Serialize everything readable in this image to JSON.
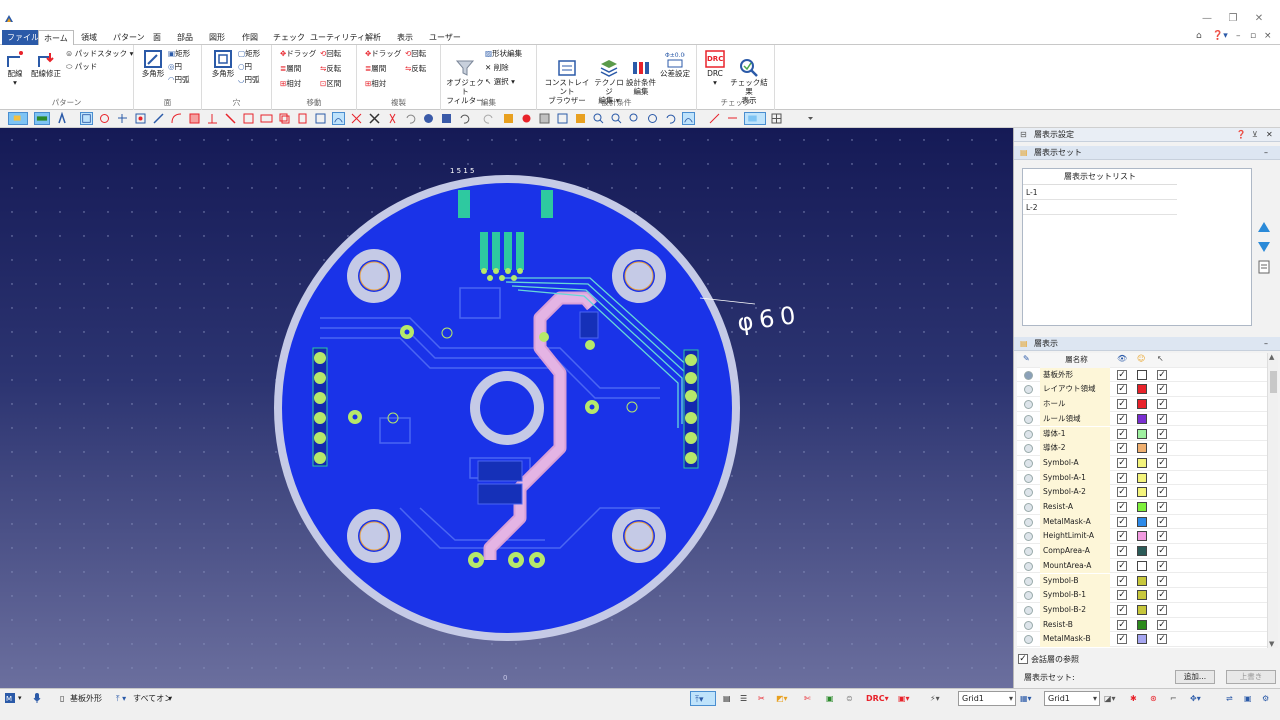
{
  "menu": {
    "items": [
      "ファイル",
      "ホーム",
      "領域",
      "パターン",
      "面",
      "部品",
      "図形",
      "作図",
      "チェック",
      "ユーティリティ",
      "解析",
      "表示",
      "ユーザー"
    ]
  },
  "ribbon": {
    "pattern": {
      "route": "配線",
      "route_edit": "配線修正",
      "pad_stack": "パッドスタック ▾",
      "pad": "パッド",
      "label": "パターン"
    },
    "plane": {
      "polygon": "多角形",
      "rect": "矩形",
      "circle": "円",
      "arc": "円弧",
      "label": "面"
    },
    "hole": {
      "polygon": "多角形",
      "rect": "矩形",
      "circle": "円",
      "arc": "円弧",
      "label": "穴"
    },
    "move": {
      "drag": "ドラッグ",
      "rotate": "回転",
      "layer": "層間",
      "flip": "反転",
      "relative": "相対",
      "mirror": "区間",
      "label": "移動"
    },
    "copy": {
      "drag": "ドラッグ",
      "rotate": "回転",
      "layer": "層間",
      "flip": "反転",
      "relative": "相対",
      "label": "複製"
    },
    "edit": {
      "filter": "オブジェクト\nフィルター",
      "shape_edit": "形状編集",
      "delete": "削除",
      "select": "選択 ▾",
      "label": "編集"
    },
    "design": {
      "constraint": "コンストレイント\nブラウザー",
      "tech": "テクノロジ\n編集 ▾",
      "cond": "設計条件\n編集",
      "tol": "公差設定",
      "label": "設計条件"
    },
    "check": {
      "drc": "DRC",
      "result": "チェック結果\n表示",
      "label": "チェック"
    }
  },
  "canvas": {
    "dimension_label": "φ60",
    "mark_label": "1 5 1 5",
    "origin_mark": "0"
  },
  "panel": {
    "title": "層表示設定",
    "set_section": "層表示セット",
    "set_list_header": "層表示セットリスト",
    "sets": [
      "L-1",
      "L-2"
    ],
    "layer_section": "層表示",
    "col_name": "層名称",
    "layers": [
      {
        "name": "基板外形",
        "color": "#ffffff"
      },
      {
        "name": "レイアウト領域",
        "color": "#e8222a"
      },
      {
        "name": "ホール",
        "color": "#e8222a"
      },
      {
        "name": "ルール領域",
        "color": "#7a2fd1"
      },
      {
        "name": "導体-1",
        "color": "#9ff0a0"
      },
      {
        "name": "導体-2",
        "color": "#f0b070"
      },
      {
        "name": "Symbol-A",
        "color": "#f4f47c"
      },
      {
        "name": "Symbol-A-1",
        "color": "#f4f47c"
      },
      {
        "name": "Symbol-A-2",
        "color": "#f4f47c"
      },
      {
        "name": "Resist-A",
        "color": "#7ef03c"
      },
      {
        "name": "MetalMask-A",
        "color": "#2d8ae8"
      },
      {
        "name": "HeightLimit-A",
        "color": "#f29ae0"
      },
      {
        "name": "CompArea-A",
        "color": "#2b5b58"
      },
      {
        "name": "MountArea-A",
        "color": "#ffffff"
      },
      {
        "name": "Symbol-B",
        "color": "#c7c73c"
      },
      {
        "name": "Symbol-B-1",
        "color": "#c7c73c"
      },
      {
        "name": "Symbol-B-2",
        "color": "#c7c73c"
      },
      {
        "name": "Resist-B",
        "color": "#2d8a1c"
      },
      {
        "name": "MetalMask-B",
        "color": "#a6a6f0"
      }
    ],
    "ref_checkbox": "会話層の参照",
    "set_label": "層表示セット:",
    "add_button": "追加...",
    "overwrite_button": "上書き"
  },
  "status": {
    "layer": "基板外形",
    "filter": "すべてオン",
    "grid1": "Grid1",
    "grid2": "Grid1"
  }
}
